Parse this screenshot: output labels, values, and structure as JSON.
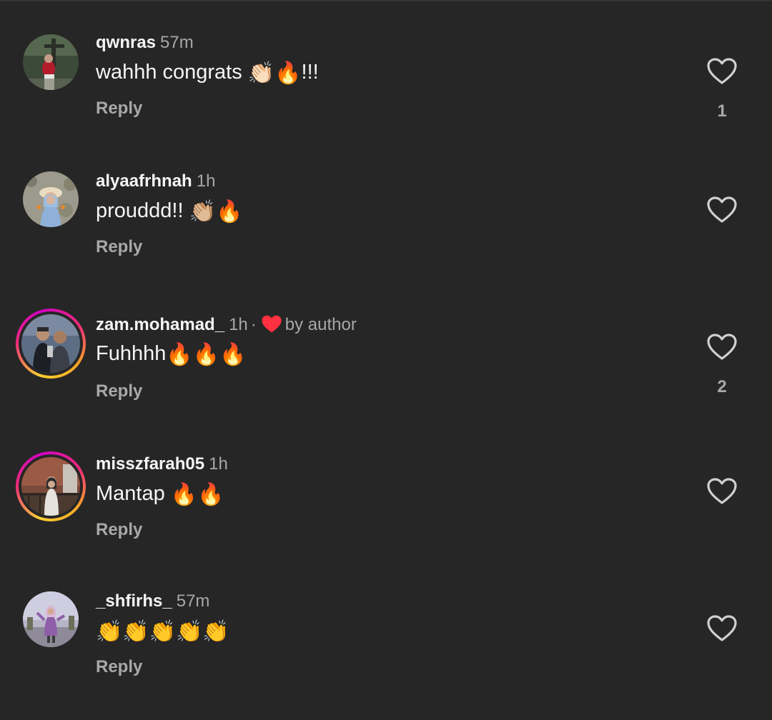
{
  "comments": [
    {
      "username": "qwnras",
      "time": "57m",
      "text": "wahhh congrats",
      "emojis": "👏🏻🔥",
      "suffix": "!!!",
      "reply": "Reply",
      "likes": "1",
      "story_ring": false
    },
    {
      "username": "alyaafrhnah",
      "time": "1h",
      "text": "prouddd!!",
      "emojis": "👏🏼🔥",
      "reply": "Reply",
      "likes": "",
      "story_ring": false
    },
    {
      "username": "zam.mohamad_",
      "time": "1h",
      "separator": "·",
      "by_author": "by author",
      "text": "Fuhhhh",
      "emojis": "🔥🔥🔥",
      "reply": "Reply",
      "likes": "2",
      "story_ring": true
    },
    {
      "username": "misszfarah05",
      "time": "1h",
      "text": "Mantap",
      "emojis": "🔥🔥",
      "reply": "Reply",
      "likes": "",
      "story_ring": true
    },
    {
      "username": "_shfirhs_",
      "time": "57m",
      "text": "",
      "emojis": "👏👏👏👏👏",
      "reply": "Reply",
      "likes": "",
      "story_ring": false
    }
  ],
  "colors": {
    "background": "#262626",
    "secondary_text": "#a8a8a8",
    "author_heart": "#ff3040"
  },
  "icons": {
    "like": "heart-outline-icon",
    "author_like": "heart-filled-icon"
  }
}
